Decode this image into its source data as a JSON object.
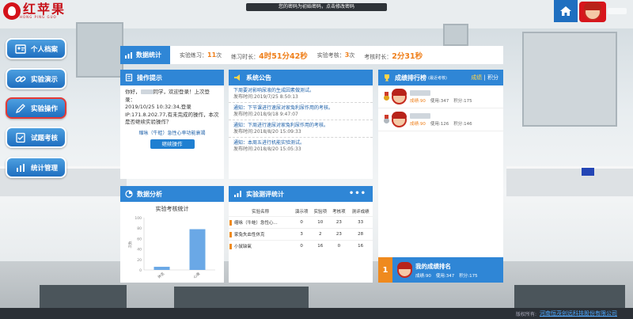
{
  "header": {
    "brand": "红苹果",
    "brand_sub": "HONG PING GUO",
    "notice": "您的密码为初始密码，点击修改密码"
  },
  "sidebar": {
    "items": [
      {
        "label": "个人档案",
        "icon": "id-card-icon"
      },
      {
        "label": "实验演示",
        "icon": "link-icon"
      },
      {
        "label": "实验操作",
        "icon": "pencil-icon",
        "active": true
      },
      {
        "label": "试题考核",
        "icon": "checklist-icon"
      },
      {
        "label": "统计管理",
        "icon": "bar-chart-icon"
      }
    ]
  },
  "stats": {
    "title": "数据统计",
    "practice_label": "实验练习：",
    "practice_count": "11",
    "practice_unit": "次",
    "practice_time_label": "练习时长：",
    "practice_time": "4时51分42秒",
    "exam_label": "实验考核：",
    "exam_count": "3",
    "exam_unit": "次",
    "exam_time_label": "考核时长：",
    "exam_time": "2分31秒"
  },
  "operation": {
    "title": "操作提示",
    "greeting_pre": "你好，",
    "greeting_post": "同学，欢迎登录！上次登录：",
    "last_login": "2019/10/25 10:32:34,登录",
    "ip_line": "IP:171.8.202.77,有未完成的操作，本次是否继续实验操作？",
    "experiment_link": "缩咏（牛蛙）急性心率功能衰竭",
    "continue_button": "继续操作"
  },
  "announcements": {
    "title": "系统公告",
    "items": [
      {
        "text": "下周要对影响尿液的生成因素做测试。",
        "date": "发布时间:2019/7/25 8:50:13"
      },
      {
        "text": "通知：下节课进行速尿对家兔利尿作用的考核。",
        "date": "发布时间:2018/9/18 9:47:07"
      },
      {
        "text": "通知：下周进行速尿对家兔利尿作用的考核。",
        "date": "发布时间:2018/8/20 15:09:33"
      },
      {
        "text": "通知：本周五进行机能实验测试。",
        "date": "发布时间:2018/8/20 15:05:33"
      }
    ]
  },
  "ranking": {
    "title": "成绩排行榜",
    "title_sub": "(最近考核)",
    "tab_score": "成绩",
    "tab_points": "积分",
    "rows": [
      {
        "score": "成绩:90",
        "usage": "使用:347",
        "points": "积分:175"
      },
      {
        "score": "成绩:90",
        "usage": "使用:126",
        "points": "积分:146"
      }
    ],
    "mine": {
      "rank": "1",
      "title": "我的成绩排名",
      "score": "成绩:90",
      "usage": "使用:347",
      "points": "积分:175"
    }
  },
  "analysis": {
    "title": "数据分析",
    "chart_title": "实验考核统计"
  },
  "chart_data": {
    "type": "bar",
    "title": "实验考核统计",
    "categories": [
      "休克",
      "心衰"
    ],
    "values": [
      6,
      78
    ],
    "ylabel": "次数",
    "ylim": [
      0,
      100
    ],
    "yticks": [
      "100",
      "80",
      "60",
      "40",
      "20",
      "0"
    ],
    "color": "#6aa8e6"
  },
  "evaluation": {
    "title": "实验测评统计",
    "columns": [
      "实验名称",
      "演示项",
      "实验项",
      "考核项",
      "测评成绩"
    ],
    "rows": [
      {
        "name": "缩咏（牛蛙）急性心...",
        "demo": "0",
        "exp": "10",
        "exam": "23",
        "score": "33"
      },
      {
        "name": "家兔失血性休克",
        "demo": "3",
        "exp": "2",
        "exam": "23",
        "score": "28"
      },
      {
        "name": "小鼠缺氧",
        "demo": "0",
        "exp": "16",
        "exam": "0",
        "score": "16"
      }
    ]
  },
  "footer": {
    "copyright": "版权所有:",
    "company": "河南恒茂创远科技股份有限公司"
  },
  "colors": {
    "primary": "#2f86d6",
    "accent": "#ef7f1a",
    "brand_red": "#d4121a"
  }
}
